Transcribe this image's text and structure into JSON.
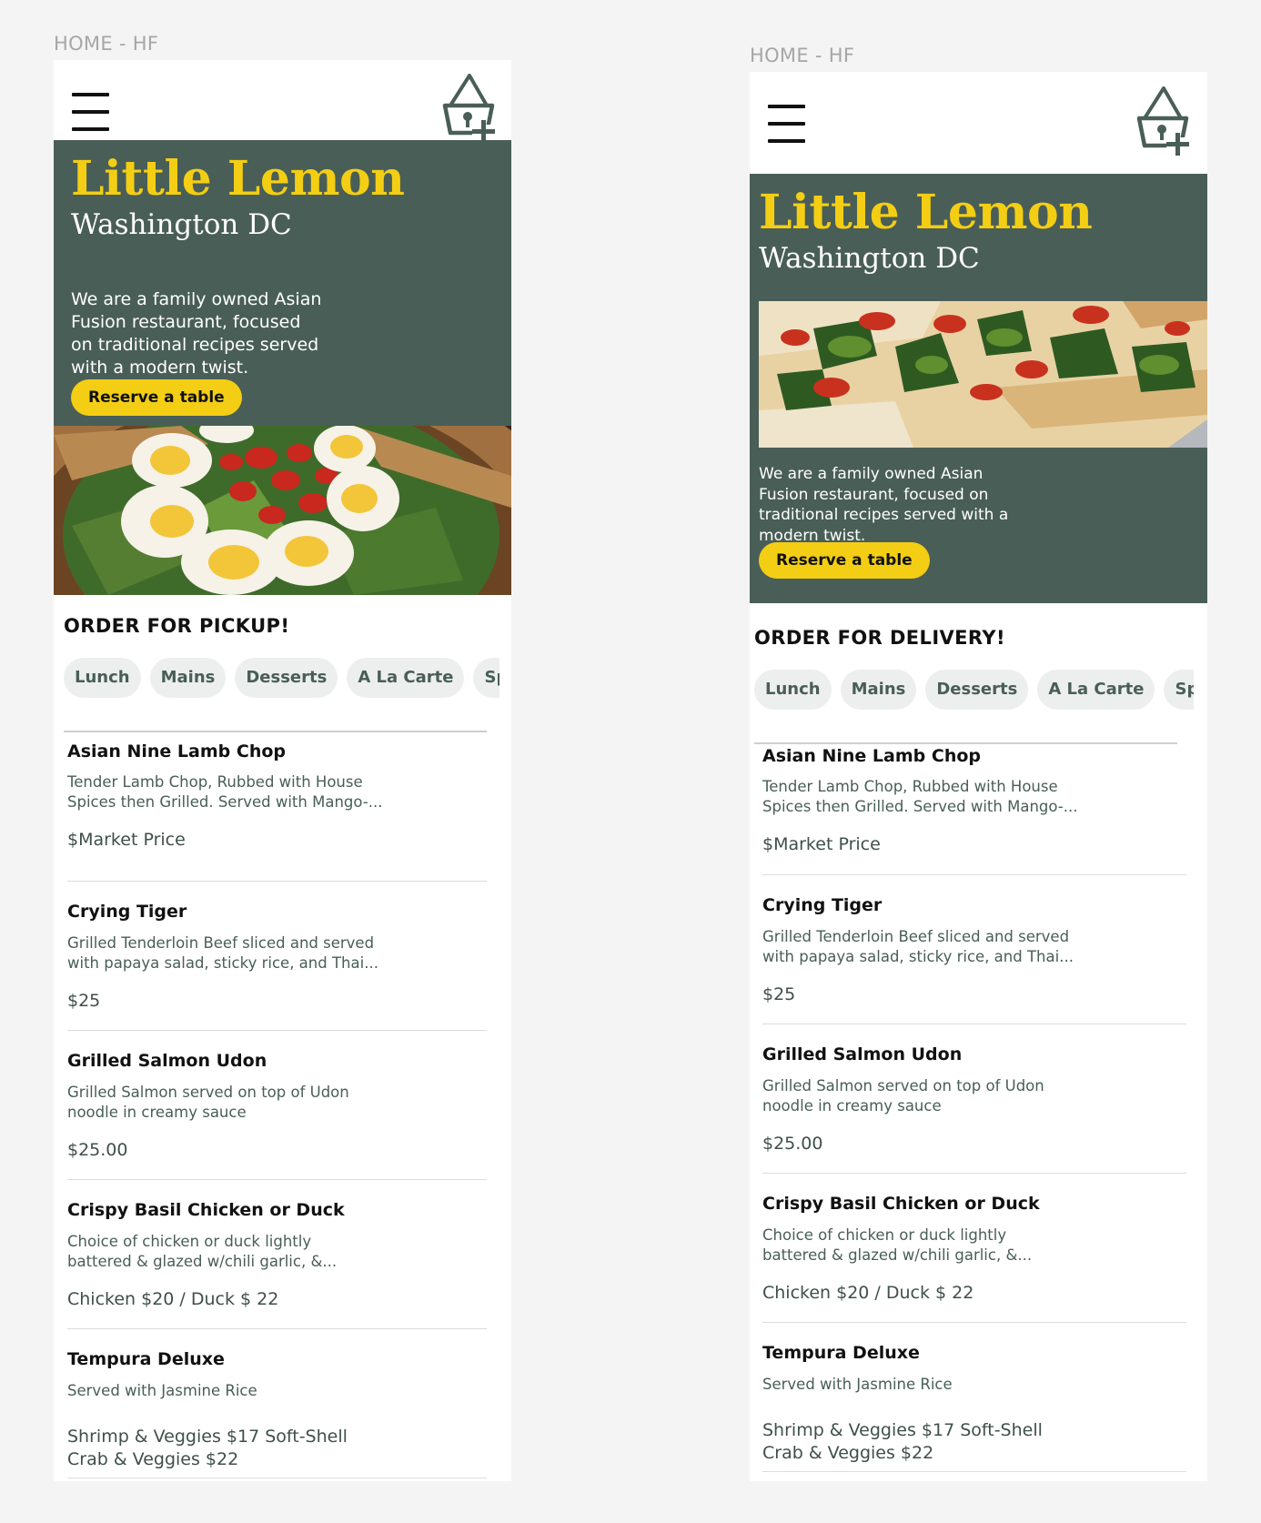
{
  "frames": [
    {
      "label": "HOME - HF",
      "brand": {
        "title": "Little Lemon",
        "city": "Washington DC"
      },
      "hero": {
        "description_lines": [
          "We are a family owned Asian",
          "Fusion restaurant, focused",
          "on traditional recipes served",
          "with a modern twist."
        ],
        "cta_label": "Reserve a table",
        "image": "salad-photo"
      },
      "order_title": "ORDER FOR PICKUP!",
      "tabs": [
        "Lunch",
        "Mains",
        "Desserts",
        "A La Carte",
        "Spe"
      ],
      "icons": {
        "menu": "hamburger-menu-icon",
        "basket": "basket-add-icon"
      }
    },
    {
      "label": "HOME - HF",
      "brand": {
        "title": "Little Lemon",
        "city": "Washington DC"
      },
      "hero": {
        "description_lines": [
          "We are a family owned Asian",
          "Fusion restaurant, focused on",
          "traditional recipes served with a",
          "modern twist."
        ],
        "cta_label": "Reserve a table",
        "image": "pizza-photo"
      },
      "order_title": "ORDER FOR DELIVERY!",
      "tabs": [
        "Lunch",
        "Mains",
        "Desserts",
        "A La Carte",
        "Spe"
      ],
      "icons": {
        "menu": "hamburger-menu-icon",
        "basket": "basket-add-icon"
      }
    }
  ],
  "menu_items": [
    {
      "name": "Asian Nine Lamb Chop",
      "desc_lines": [
        "Tender Lamb Chop, Rubbed with House",
        "Spices then Grilled. Served with Mango-..."
      ],
      "price_lines": [
        "$Market Price"
      ]
    },
    {
      "name": "Crying Tiger",
      "desc_lines": [
        "Grilled Tenderloin Beef sliced and served",
        "with papaya salad, sticky rice, and Thai..."
      ],
      "price_lines": [
        "$25"
      ]
    },
    {
      "name": "Grilled Salmon Udon",
      "desc_lines": [
        "Grilled Salmon served on top of Udon",
        "noodle in creamy sauce"
      ],
      "price_lines": [
        "$25.00"
      ]
    },
    {
      "name": "Crispy Basil Chicken or Duck",
      "desc_lines": [
        "Choice of chicken or duck lightly",
        "battered & glazed w/chili garlic, &..."
      ],
      "price_lines": [
        "Chicken $20 / Duck $ 22"
      ]
    },
    {
      "name": "Tempura Deluxe",
      "desc_lines": [
        "Served with Jasmine Rice"
      ],
      "price_lines": [
        "Shrimp & Veggies $17 Soft-Shell",
        "Crab & Veggies $22"
      ]
    }
  ],
  "colors": {
    "primary_green": "#495e57",
    "primary_yellow": "#f4ce14",
    "tab_background": "#edefee",
    "page_background": "#f4f4f4"
  }
}
